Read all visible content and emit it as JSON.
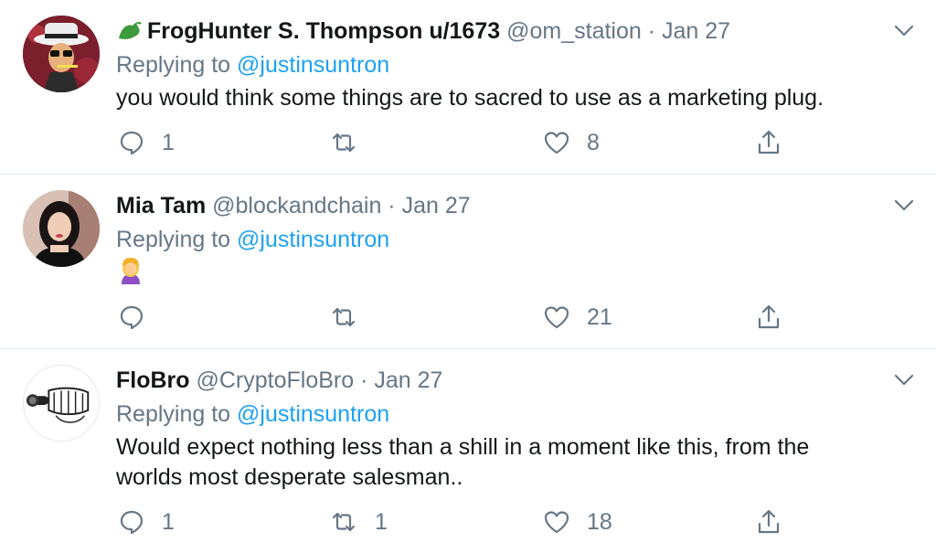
{
  "tweets": [
    {
      "display_name": "FrogHunter S. Thompson u/1673",
      "handle": "@om_station",
      "separator": "·",
      "date": "Jan 27",
      "replying_prefix": "Replying to",
      "replying_to": "@justinsuntron",
      "text": "you would think some things are to sacred to use as a marketing plug.",
      "reply_count": "1",
      "retweet_count": "",
      "like_count": "8"
    },
    {
      "display_name": "Mia Tam",
      "handle": "@blockandchain",
      "separator": "·",
      "date": "Jan 27",
      "replying_prefix": "Replying to",
      "replying_to": "@justinsuntron",
      "text": "",
      "emoji": "facepalm",
      "reply_count": "",
      "retweet_count": "",
      "like_count": "21"
    },
    {
      "display_name": "FloBro",
      "handle": "@CryptoFloBro",
      "separator": "·",
      "date": "Jan 27",
      "replying_prefix": "Replying to",
      "replying_to": "@justinsuntron",
      "text": "Would expect nothing less than a shill in a moment like this, from the worlds most desperate salesman..",
      "reply_count": "1",
      "retweet_count": "1",
      "like_count": "18"
    }
  ],
  "colors": {
    "text": "#14171a",
    "muted": "#657786",
    "link": "#1da1f2",
    "divider": "#e1e8ed"
  }
}
